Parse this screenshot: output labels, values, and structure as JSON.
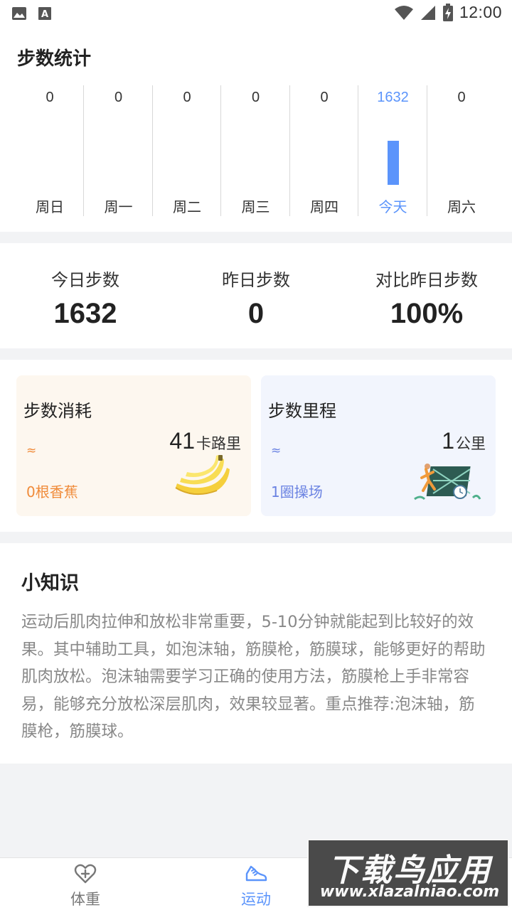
{
  "status_bar": {
    "time": "12:00",
    "left_icons": [
      "image-icon",
      "font-icon"
    ],
    "right_icons": [
      "wifi-icon",
      "signal-icon",
      "battery-icon"
    ]
  },
  "week": {
    "title": "步数统计",
    "days": [
      {
        "label": "周日",
        "value": "0",
        "steps": 0,
        "today": false
      },
      {
        "label": "周一",
        "value": "0",
        "steps": 0,
        "today": false
      },
      {
        "label": "周二",
        "value": "0",
        "steps": 0,
        "today": false
      },
      {
        "label": "周三",
        "value": "0",
        "steps": 0,
        "today": false
      },
      {
        "label": "周四",
        "value": "0",
        "steps": 0,
        "today": false
      },
      {
        "label": "今天",
        "value": "1632",
        "steps": 1632,
        "today": true
      },
      {
        "label": "周六",
        "value": "0",
        "steps": 0,
        "today": false
      }
    ],
    "bar_color": "#5b94fb"
  },
  "summary": {
    "today_label": "今日步数",
    "today_value": "1632",
    "yesterday_label": "昨日步数",
    "yesterday_value": "0",
    "compare_label": "对比昨日步数",
    "compare_value": "100%"
  },
  "cards": {
    "calories": {
      "title": "步数消耗",
      "approx": "≈",
      "value": "41",
      "unit": "卡路里",
      "equivalent": "0根香蕉",
      "image": "banana-image",
      "accent": "#f08b3a"
    },
    "distance": {
      "title": "步数里程",
      "approx": "≈",
      "value": "1",
      "unit": "公里",
      "equivalent": "1圈操场",
      "image": "runner-track-image",
      "accent": "#6a82e2"
    }
  },
  "tips": {
    "title": "小知识",
    "body": "运动后肌肉拉伸和放松非常重要，5-10分钟就能起到比较好的效果。其中辅助工具，如泡沫轴，筋膜枪，筋膜球，能够更好的帮助肌肉放松。泡沫轴需要学习正确的使用方法，筋膜枪上手非常容易，能够充分放松深层肌肉，效果较显著。重点推荐:泡沫轴，筋膜枪，筋膜球。"
  },
  "bottom_nav": {
    "items": [
      {
        "label": "体重",
        "icon": "heart-plus-icon",
        "active": false
      },
      {
        "label": "运动",
        "icon": "sneaker-icon",
        "active": true
      }
    ],
    "active_color": "#5b94fb"
  },
  "watermark": {
    "line1": "下载鸟应用",
    "line2": "www.xlazalniao.com"
  }
}
